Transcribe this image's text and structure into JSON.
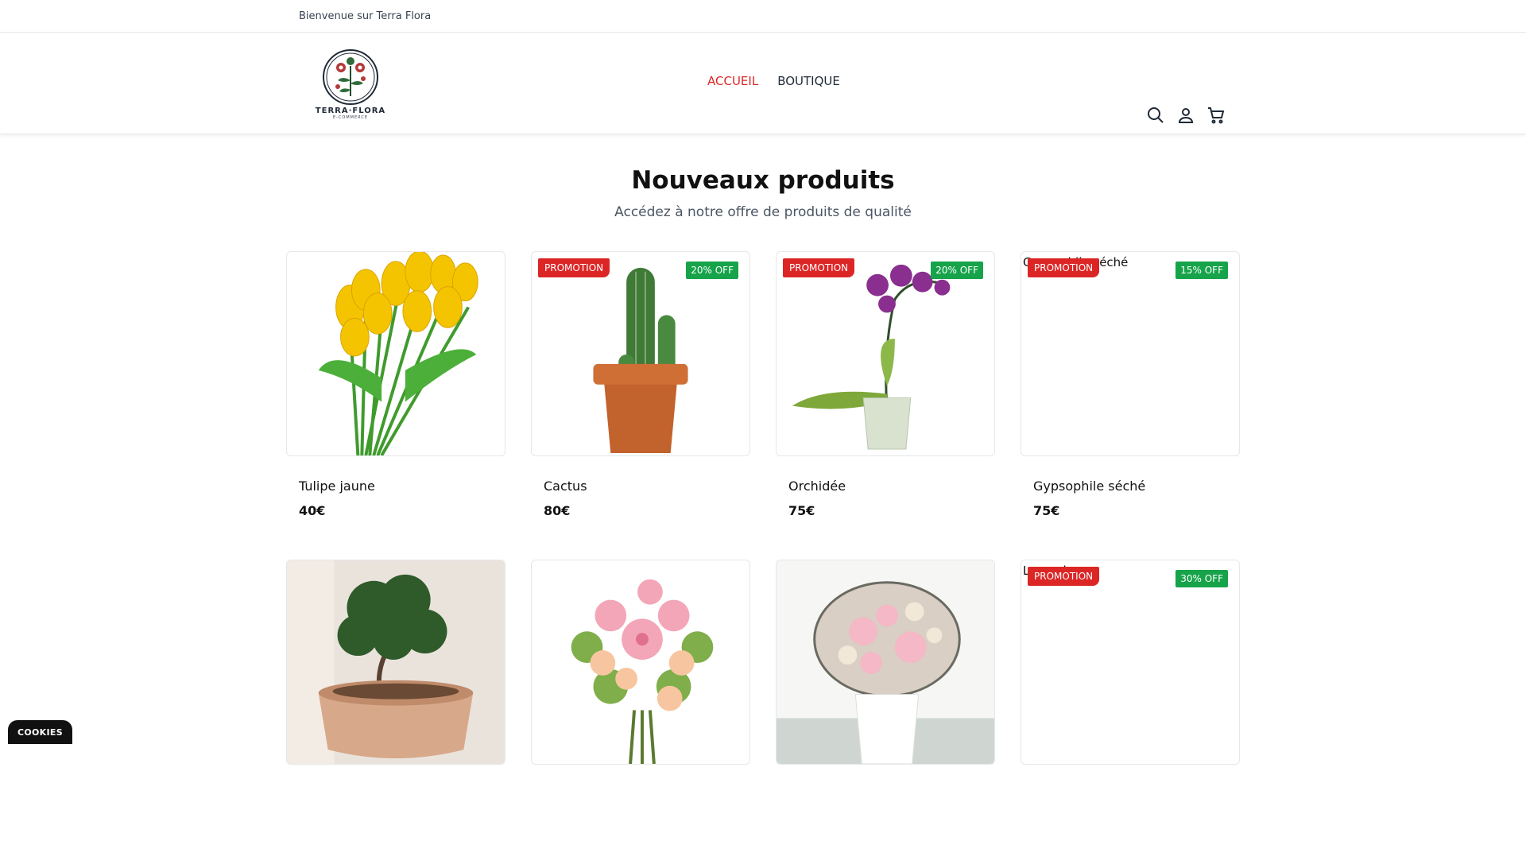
{
  "topbar": {
    "welcome": "Bienvenue sur Terra Flora"
  },
  "header": {
    "logo": {
      "brand": "TERRA·FLORA",
      "tagline": "E-COMMERCE"
    },
    "nav": [
      {
        "label": "ACCUEIL",
        "active": true
      },
      {
        "label": "BOUTIQUE",
        "active": false
      }
    ],
    "icons": [
      "search-icon",
      "user-icon",
      "cart-icon"
    ]
  },
  "section": {
    "title": "Nouveaux produits",
    "subtitle": "Accédez à notre offre de produits de qualité"
  },
  "products": [
    {
      "name": "Tulipe jaune",
      "price": "40€",
      "promo": "",
      "discount": "",
      "alt": "",
      "image": "yellow-tulips"
    },
    {
      "name": "Cactus",
      "price": "80€",
      "promo": "PROMOTION",
      "discount": "20% OFF",
      "alt": "",
      "image": "cactus-in-pot"
    },
    {
      "name": "Orchidée",
      "price": "75€",
      "promo": "PROMOTION",
      "discount": "20% OFF",
      "alt": "",
      "image": "purple-orchid"
    },
    {
      "name": "Gypsophile séché",
      "price": "75€",
      "promo": "PROMOTION",
      "discount": "15% OFF",
      "alt": "Gypsophile séché",
      "image": "broken-image"
    },
    {
      "name": "",
      "price": "",
      "promo": "",
      "discount": "",
      "alt": "",
      "image": "bonsai"
    },
    {
      "name": "",
      "price": "",
      "promo": "",
      "discount": "",
      "alt": "",
      "image": "pink-bouquet"
    },
    {
      "name": "",
      "price": "",
      "promo": "",
      "discount": "",
      "alt": "",
      "image": "dried-flowers-jug"
    },
    {
      "name": "",
      "price": "",
      "promo": "PROMOTION",
      "discount": "30% OFF",
      "alt": "Lavande",
      "image": "broken-image"
    }
  ],
  "cookies": {
    "label": "COOKIES"
  },
  "colors": {
    "accent": "#dc2626",
    "promo": "#dc2626",
    "discount": "#16a34a"
  }
}
